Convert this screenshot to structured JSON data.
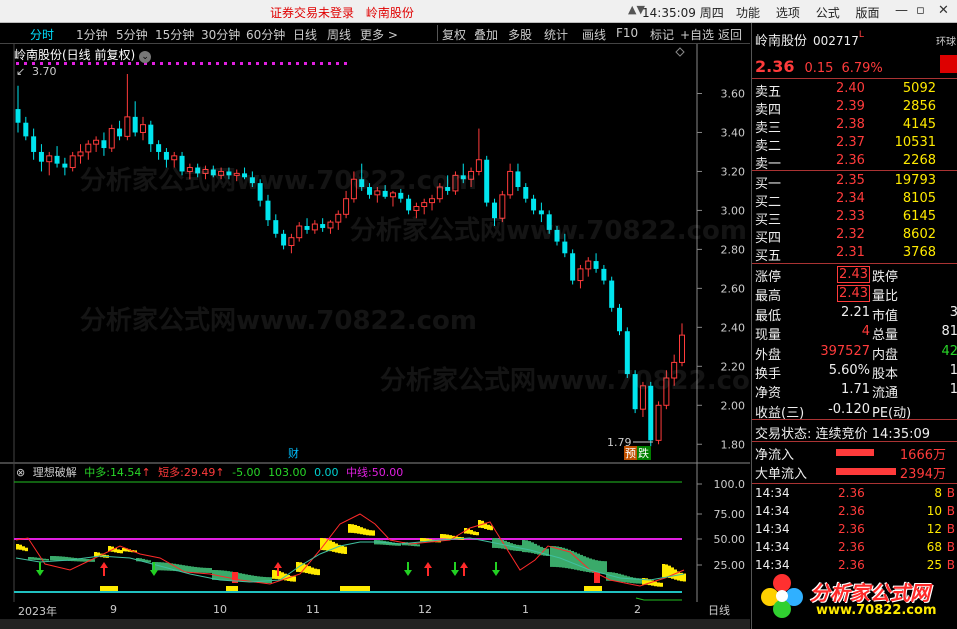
{
  "titlebar": {
    "notice": "证券交易未登录",
    "stock_name": "岭南股份",
    "time": "14:35:09 周四",
    "menus": [
      "功能",
      "选项",
      "公式",
      "版面"
    ]
  },
  "toolbar": {
    "periods": [
      "分时",
      "1分钟",
      "5分钟",
      "15分钟",
      "30分钟",
      "60分钟",
      "日线",
      "周线",
      "更多 >"
    ],
    "active_period": "分时",
    "actions": [
      "复权",
      "叠加",
      "多股",
      "统计",
      "画线",
      "F10",
      "标记",
      "+自选",
      "返回"
    ]
  },
  "chart": {
    "title": "岭南股份(日线 前复权)",
    "high_label": "3.70",
    "low_label": "1.79",
    "marker_cai": "财",
    "marker_yu": "预",
    "marker_die": "跌",
    "price_axis": [
      "3.60",
      "3.40",
      "3.20",
      "3.00",
      "2.80",
      "2.60",
      "2.40",
      "2.20",
      "2.00",
      "1.80"
    ],
    "candles": [
      [
        3.52,
        3.64,
        3.4,
        3.45
      ],
      [
        3.45,
        3.48,
        3.36,
        3.38
      ],
      [
        3.38,
        3.42,
        3.26,
        3.3
      ],
      [
        3.3,
        3.34,
        3.2,
        3.25
      ],
      [
        3.25,
        3.3,
        3.18,
        3.28
      ],
      [
        3.28,
        3.33,
        3.22,
        3.24
      ],
      [
        3.24,
        3.27,
        3.18,
        3.22
      ],
      [
        3.22,
        3.3,
        3.2,
        3.28
      ],
      [
        3.28,
        3.34,
        3.24,
        3.3
      ],
      [
        3.3,
        3.36,
        3.26,
        3.34
      ],
      [
        3.34,
        3.38,
        3.3,
        3.36
      ],
      [
        3.36,
        3.4,
        3.28,
        3.32
      ],
      [
        3.32,
        3.44,
        3.3,
        3.42
      ],
      [
        3.42,
        3.46,
        3.36,
        3.38
      ],
      [
        3.38,
        3.7,
        3.36,
        3.48
      ],
      [
        3.48,
        3.56,
        3.38,
        3.4
      ],
      [
        3.4,
        3.48,
        3.36,
        3.44
      ],
      [
        3.44,
        3.46,
        3.3,
        3.34
      ],
      [
        3.34,
        3.36,
        3.26,
        3.3
      ],
      [
        3.3,
        3.32,
        3.22,
        3.26
      ],
      [
        3.26,
        3.3,
        3.22,
        3.28
      ],
      [
        3.28,
        3.3,
        3.18,
        3.2
      ],
      [
        3.2,
        3.24,
        3.16,
        3.22
      ],
      [
        3.22,
        3.24,
        3.17,
        3.19
      ],
      [
        3.19,
        3.23,
        3.16,
        3.21
      ],
      [
        3.21,
        3.23,
        3.17,
        3.18
      ],
      [
        3.18,
        3.22,
        3.16,
        3.2
      ],
      [
        3.2,
        3.22,
        3.16,
        3.18
      ],
      [
        3.18,
        3.21,
        3.15,
        3.19
      ],
      [
        3.19,
        3.22,
        3.16,
        3.17
      ],
      [
        3.17,
        3.2,
        3.12,
        3.14
      ],
      [
        3.14,
        3.16,
        3.02,
        3.05
      ],
      [
        3.05,
        3.08,
        2.92,
        2.95
      ],
      [
        2.95,
        2.98,
        2.86,
        2.88
      ],
      [
        2.88,
        2.9,
        2.8,
        2.82
      ],
      [
        2.82,
        2.88,
        2.78,
        2.86
      ],
      [
        2.86,
        2.94,
        2.84,
        2.92
      ],
      [
        2.92,
        2.96,
        2.88,
        2.9
      ],
      [
        2.9,
        2.95,
        2.88,
        2.93
      ],
      [
        2.93,
        2.96,
        2.89,
        2.91
      ],
      [
        2.91,
        2.95,
        2.88,
        2.94
      ],
      [
        2.94,
        3.0,
        2.9,
        2.98
      ],
      [
        2.98,
        3.1,
        2.96,
        3.06
      ],
      [
        3.06,
        3.2,
        3.04,
        3.16
      ],
      [
        3.16,
        3.24,
        3.1,
        3.12
      ],
      [
        3.12,
        3.14,
        3.06,
        3.08
      ],
      [
        3.08,
        3.12,
        3.04,
        3.1
      ],
      [
        3.1,
        3.13,
        3.06,
        3.07
      ],
      [
        3.07,
        3.1,
        3.02,
        3.09
      ],
      [
        3.09,
        3.11,
        3.04,
        3.06
      ],
      [
        3.06,
        3.08,
        2.98,
        3.0
      ],
      [
        3.0,
        3.04,
        2.96,
        3.02
      ],
      [
        3.02,
        3.06,
        2.98,
        3.04
      ],
      [
        3.04,
        3.08,
        3.0,
        3.06
      ],
      [
        3.06,
        3.14,
        3.04,
        3.12
      ],
      [
        3.12,
        3.18,
        3.08,
        3.1
      ],
      [
        3.1,
        3.2,
        3.08,
        3.18
      ],
      [
        3.18,
        3.24,
        3.14,
        3.16
      ],
      [
        3.16,
        3.22,
        3.12,
        3.2
      ],
      [
        3.2,
        3.42,
        3.18,
        3.26
      ],
      [
        3.26,
        3.28,
        3.02,
        3.04
      ],
      [
        3.04,
        3.06,
        2.92,
        2.96
      ],
      [
        2.96,
        3.1,
        2.94,
        3.08
      ],
      [
        3.08,
        3.24,
        3.06,
        3.2
      ],
      [
        3.2,
        3.24,
        3.1,
        3.12
      ],
      [
        3.12,
        3.14,
        3.04,
        3.06
      ],
      [
        3.06,
        3.08,
        2.98,
        3.0
      ],
      [
        3.0,
        3.04,
        2.94,
        2.98
      ],
      [
        2.98,
        3.0,
        2.88,
        2.9
      ],
      [
        2.9,
        2.92,
        2.82,
        2.84
      ],
      [
        2.84,
        2.88,
        2.76,
        2.78
      ],
      [
        2.78,
        2.8,
        2.62,
        2.64
      ],
      [
        2.64,
        2.72,
        2.6,
        2.7
      ],
      [
        2.7,
        2.76,
        2.66,
        2.74
      ],
      [
        2.74,
        2.78,
        2.68,
        2.7
      ],
      [
        2.7,
        2.72,
        2.62,
        2.64
      ],
      [
        2.64,
        2.66,
        2.48,
        2.5
      ],
      [
        2.5,
        2.52,
        2.36,
        2.38
      ],
      [
        2.38,
        2.4,
        2.14,
        2.16
      ],
      [
        2.16,
        2.18,
        1.96,
        1.98
      ],
      [
        1.98,
        2.12,
        1.94,
        2.1
      ],
      [
        2.1,
        2.12,
        1.79,
        1.82
      ],
      [
        1.82,
        2.02,
        1.8,
        2.0
      ],
      [
        2.0,
        2.18,
        1.98,
        2.14
      ],
      [
        2.14,
        2.26,
        2.1,
        2.22
      ],
      [
        2.22,
        2.42,
        2.2,
        2.36
      ]
    ]
  },
  "indicator": {
    "name": "理想破解",
    "zhongduo_label": "中多:",
    "zhongduo_value": "14.54",
    "duanduo_label": "短多:",
    "duanduo_value": "29.49",
    "v3": "-5.00",
    "v4": "103.00",
    "v5": "0.00",
    "zhongxian_label": "中线:",
    "zhongxian_value": "50.00",
    "axis": [
      "100.0",
      "75.00",
      "50.00",
      "25.00"
    ]
  },
  "date_axis": [
    "2023年",
    "9",
    "10",
    "11",
    "12",
    "1",
    "2"
  ],
  "bottom_tab": "日线",
  "panel": {
    "name": "岭南股份",
    "code": "002717",
    "flag": "L",
    "tag": "环球",
    "price": "2.36",
    "change": "0.15",
    "pct": "6.79%",
    "asks": [
      {
        "label": "卖五",
        "price": "2.40",
        "vol": "5092"
      },
      {
        "label": "卖四",
        "price": "2.39",
        "vol": "2856"
      },
      {
        "label": "卖三",
        "price": "2.38",
        "vol": "4145"
      },
      {
        "label": "卖二",
        "price": "2.37",
        "vol": "10531"
      },
      {
        "label": "卖一",
        "price": "2.36",
        "vol": "2268"
      }
    ],
    "bids": [
      {
        "label": "买一",
        "price": "2.35",
        "vol": "19793"
      },
      {
        "label": "买二",
        "price": "2.34",
        "vol": "8105"
      },
      {
        "label": "买三",
        "price": "2.33",
        "vol": "6145"
      },
      {
        "label": "买四",
        "price": "2.32",
        "vol": "8602"
      },
      {
        "label": "买五",
        "price": "2.31",
        "vol": "3768"
      }
    ],
    "stats": [
      {
        "l1": "涨停",
        "v1": "2.43",
        "l2": "跌停",
        "v2": ""
      },
      {
        "l1": "最高",
        "v1": "2.43",
        "l2": "量比",
        "v2": ""
      },
      {
        "l1": "最低",
        "v1": "2.21",
        "l2": "市值",
        "v2": "3"
      },
      {
        "l1": "现量",
        "v1": "4",
        "l2": "总量",
        "v2": "81"
      },
      {
        "l1": "外盘",
        "v1": "397527",
        "l2": "内盘",
        "v2": "42"
      },
      {
        "l1": "换手",
        "v1": "5.60%",
        "l2": "股本",
        "v2": "1"
      },
      {
        "l1": "净资",
        "v1": "1.71",
        "l2": "流通",
        "v2": "1"
      },
      {
        "l1": "收益(三)",
        "v1": "-0.120",
        "l2": "PE(动)",
        "v2": ""
      }
    ],
    "state_label": "交易状态:",
    "state_value": "连续竞价",
    "state_time": "14:35:09",
    "net_inflow_label": "净流入",
    "net_inflow_value": "1666万",
    "big_inflow_label": "大单流入",
    "big_inflow_value": "2394万",
    "ticks": [
      {
        "t": "14:34",
        "p": "2.36",
        "v": "8",
        "f": "B"
      },
      {
        "t": "14:34",
        "p": "2.36",
        "v": "10",
        "f": "B"
      },
      {
        "t": "14:34",
        "p": "2.36",
        "v": "12",
        "f": "B"
      },
      {
        "t": "14:34",
        "p": "2.36",
        "v": "68",
        "f": "B"
      },
      {
        "t": "14:34",
        "p": "2.36",
        "v": "25",
        "f": "B"
      }
    ],
    "logo_name": "分析家公式网",
    "logo_url": "www.70822.com"
  },
  "watermark": "分析家公式网www.70822.com",
  "colors": {
    "up": "#ff3b3b",
    "down": "#00e5ee",
    "magenta": "#e020e0",
    "yellow": "#ffea00",
    "green_band": "#3aaa6a"
  }
}
